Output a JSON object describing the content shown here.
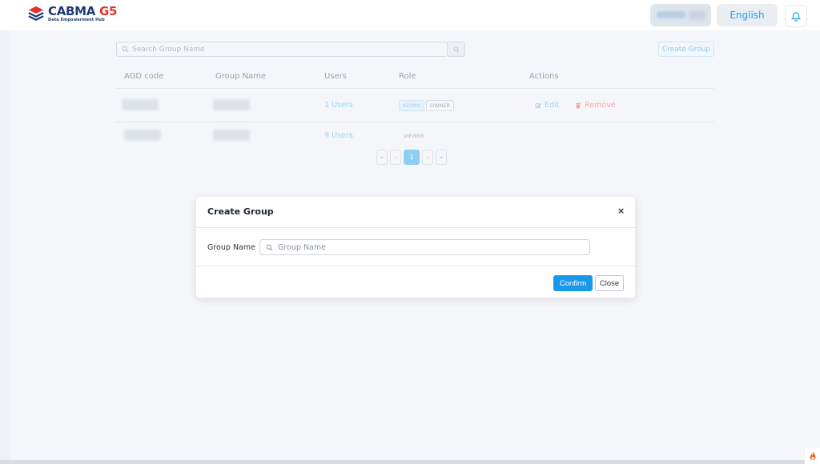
{
  "header": {
    "logo_name": "CABMA",
    "logo_version": "G5",
    "logo_tagline": "Data Empowerment Hub",
    "language_label": "English",
    "icons": {
      "logo": "layers-logo-icon",
      "notifications": "bell-icon"
    }
  },
  "toolbar": {
    "search_placeholder": "Search Group Name",
    "create_group_label": "Create Group",
    "icons": {
      "search": "search-icon"
    }
  },
  "table": {
    "columns": [
      "AGD code",
      "Group Name",
      "Users",
      "Role",
      "Actions"
    ],
    "rows": [
      {
        "users": "1 Users",
        "roles": [
          "ADMIN",
          "OWNER"
        ],
        "edit_label": "Edit",
        "remove_label": "Remove"
      },
      {
        "users": "9 Users",
        "roles": [
          "VIEWER"
        ]
      }
    ]
  },
  "pagination": {
    "first": "«",
    "prev": "‹",
    "current": "1",
    "next": "›",
    "last": "»"
  },
  "modal": {
    "title": "Create Group",
    "close_symbol": "×",
    "field_label": "Group Name",
    "field_placeholder": "Group Name",
    "field_value": "",
    "confirm_label": "Confirm",
    "close_label": "Close"
  },
  "colors": {
    "brand_navy": "#1f3b72",
    "brand_red": "#e5322d",
    "accent_blue": "#1a98e8",
    "remove_red": "#e25c5c"
  }
}
